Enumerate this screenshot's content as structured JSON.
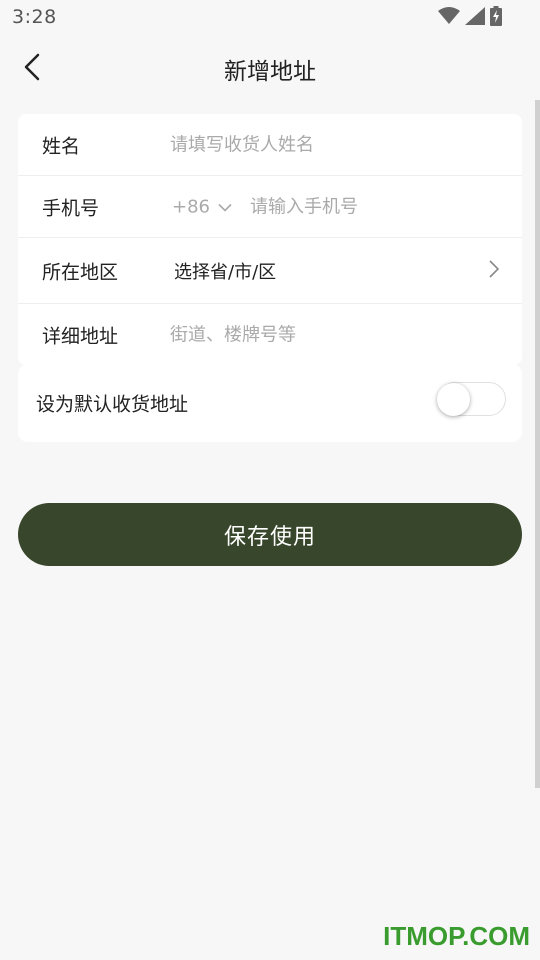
{
  "status_bar": {
    "time": "3:28",
    "icons": [
      "wifi-icon",
      "signal-icon",
      "battery-charging-icon"
    ]
  },
  "header": {
    "title": "新增地址",
    "back_icon": "chevron-left-icon"
  },
  "form": {
    "name": {
      "label": "姓名",
      "placeholder": "请填写收货人姓名",
      "value": ""
    },
    "phone": {
      "label": "手机号",
      "country_code": "+86",
      "placeholder": "请输入手机号",
      "value": ""
    },
    "region": {
      "label": "所在地区",
      "value": "选择省/市/区"
    },
    "detail": {
      "label": "详细地址",
      "placeholder": "街道、楼牌号等",
      "value": ""
    }
  },
  "default_address": {
    "label": "设为默认收货地址",
    "enabled": false
  },
  "save_button": {
    "label": "保存使用"
  },
  "colors": {
    "accent": "#38472b",
    "background": "#f7f7f7",
    "card": "#ffffff",
    "placeholder": "#aaaaaa",
    "watermark": "#3a9c2f"
  },
  "watermark": "ITMOP.COM"
}
